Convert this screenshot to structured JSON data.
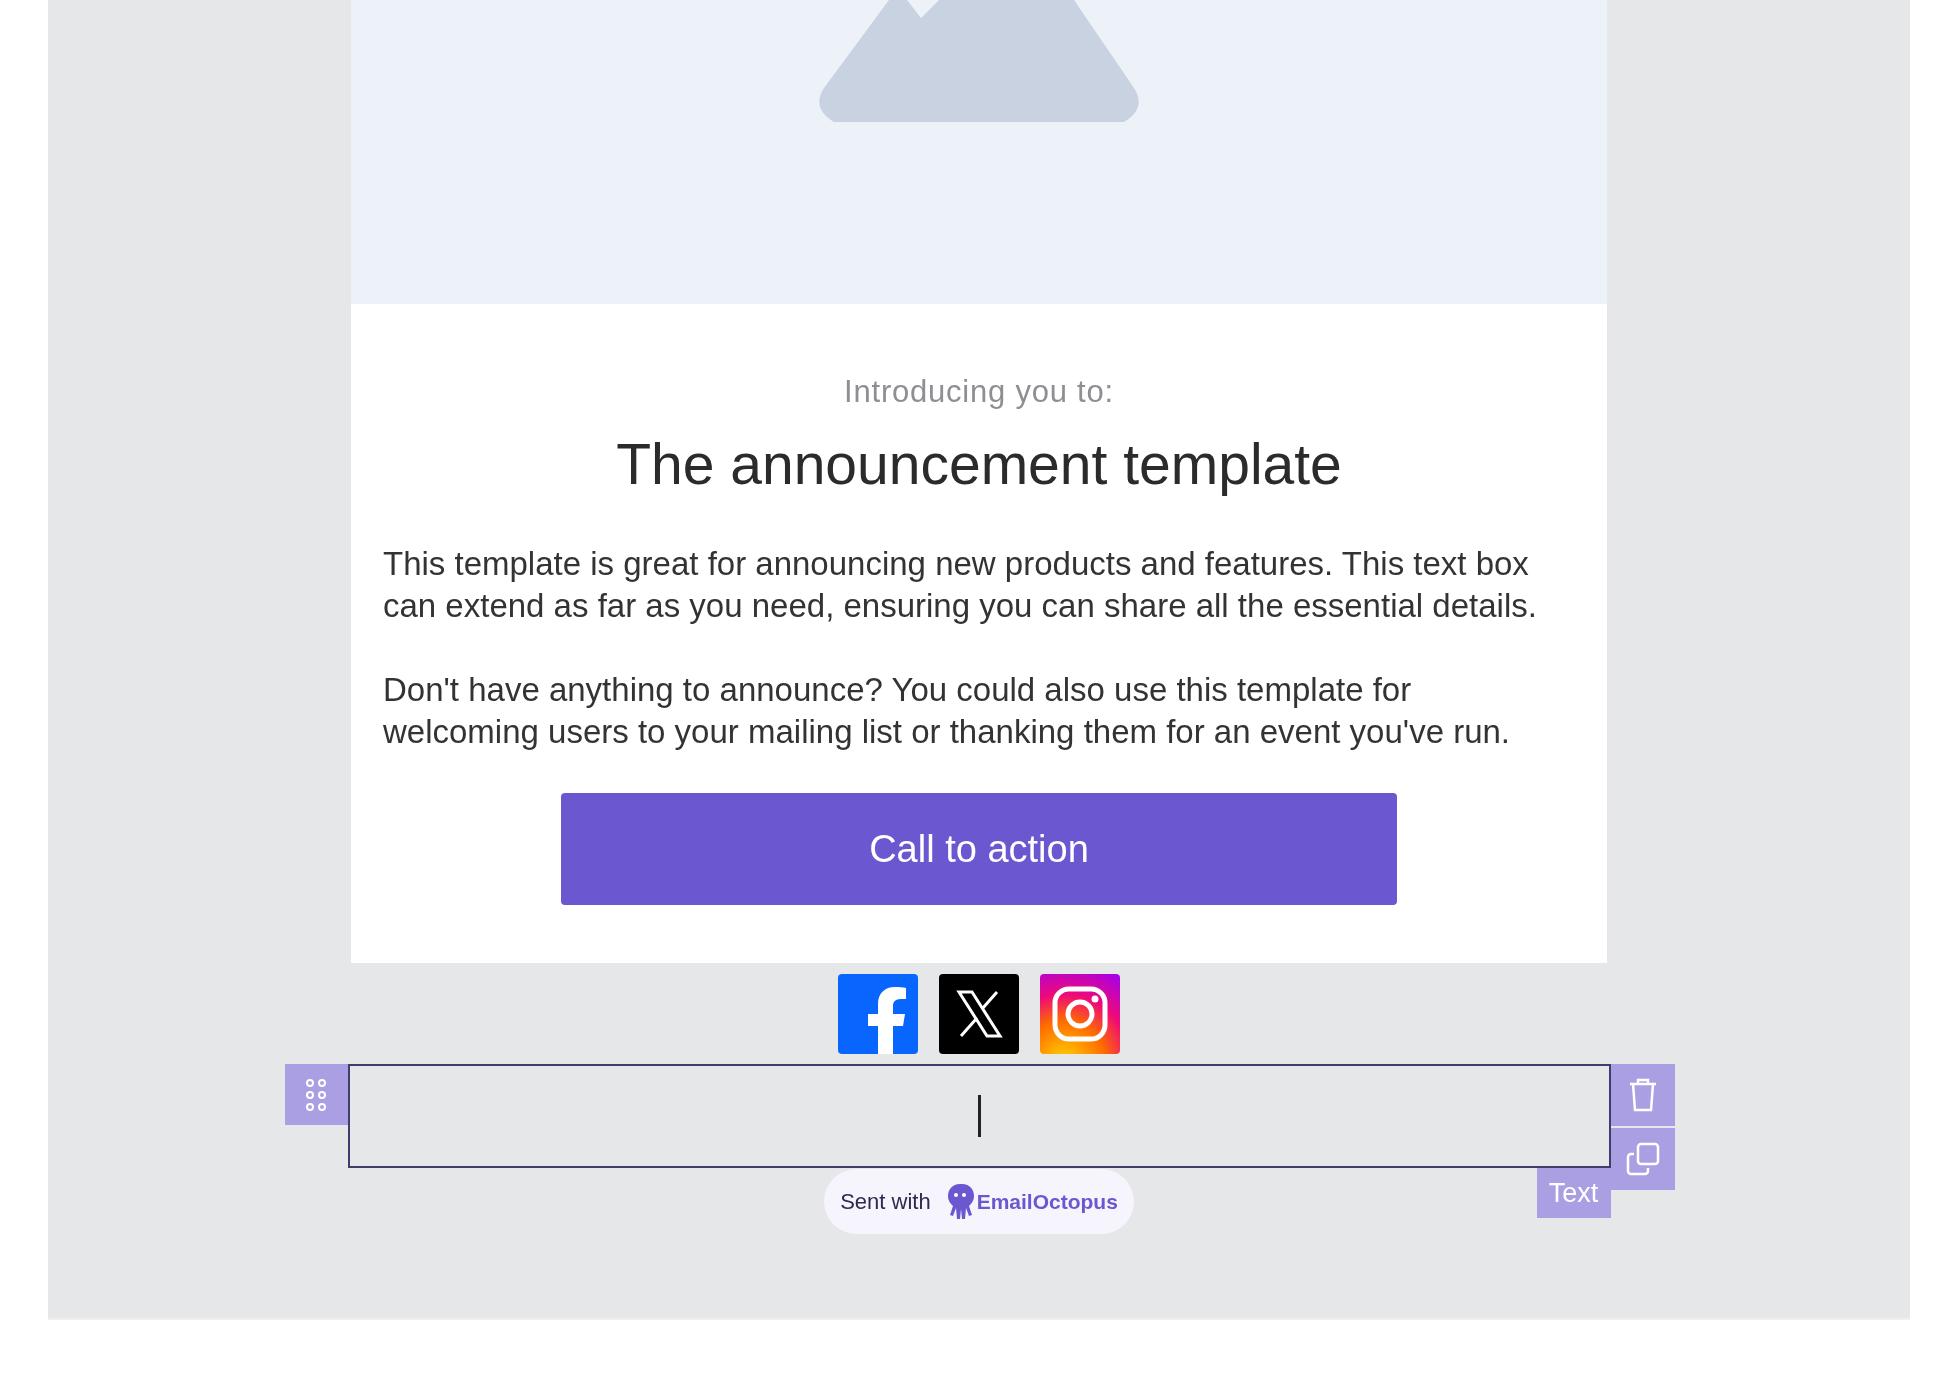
{
  "email": {
    "subtitle": "Introducing you to:",
    "heading": "The announcement template",
    "paragraphs": [
      "This template is great for announcing new products and features. This text box can extend as far as you need, ensuring you can share all the essential details.",
      "Don't have anything to announce? You could also use this template for welcoming users to your mailing list or thanking them for an event you've run."
    ],
    "button": "Call to action"
  },
  "social": [
    {
      "kind": "facebook"
    },
    {
      "kind": "x"
    },
    {
      "kind": "instagram"
    }
  ],
  "selected_block": {
    "label": "Text"
  },
  "badge": {
    "text": "Sent with",
    "brand": "EmailOctopus"
  }
}
